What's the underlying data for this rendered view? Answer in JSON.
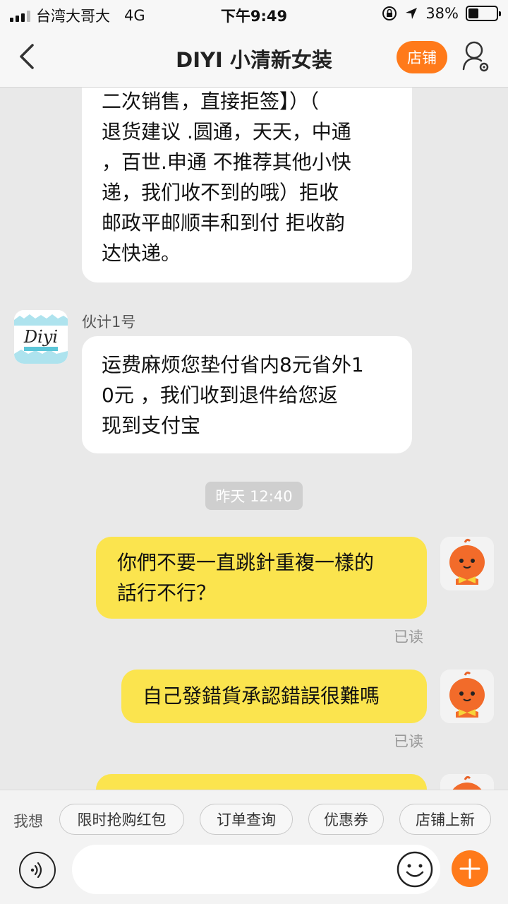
{
  "status_bar": {
    "carrier": "台湾大哥大",
    "network": "4G",
    "time": "下午9:49",
    "battery": "38%"
  },
  "header": {
    "title": "DIYI 小清新女装",
    "shop_label": "店铺"
  },
  "chat": {
    "msg1_lines": [
      "二次销售，直接拒签】）（",
      "退货建议 .圆通，天天，中通",
      "，百世.申通 不推荐其他小快",
      "递，我们收不到的哦）拒收",
      "邮政平邮顺丰和到付 拒收韵",
      "达快递。"
    ],
    "shop_avatar_text": "Diyi",
    "sender_name": "伙计1号",
    "msg2_lines": [
      "运费麻烦您垫付省内8元省外1",
      "0元 ，我们收到退件给您返",
      "现到支付宝"
    ],
    "timestamp": "昨天 12:40",
    "msg3_lines": [
      "你們不要一直跳針重複一樣的",
      "話行不行？"
    ],
    "msg3_read": "已读",
    "msg4_lines": [
      "自己發錯貨承認錯誤很難嗎"
    ],
    "msg4_read": "已读"
  },
  "quick_bar": {
    "label": "我想",
    "chips": [
      "限时抢购红包",
      "订单查询",
      "优惠券",
      "店铺上新"
    ]
  },
  "input_bar": {
    "placeholder": ""
  },
  "colors": {
    "accent": "#ff7a1a",
    "my_bubble": "#fbe44e",
    "shop_bubble": "#ffffff"
  }
}
